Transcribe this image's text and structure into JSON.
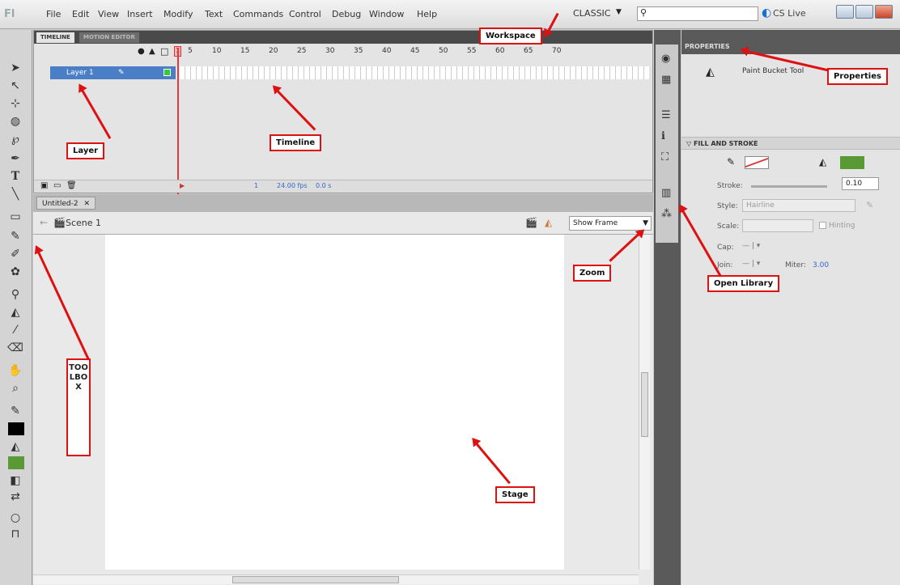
{
  "menu": {
    "items": [
      "File",
      "Edit",
      "View",
      "Insert",
      "Modify",
      "Text",
      "Commands",
      "Control",
      "Debug",
      "Window",
      "Help"
    ],
    "workspace": "CLASSIC",
    "cs_live": "CS Live"
  },
  "timeline": {
    "tabs": [
      "TIMELINE",
      "MOTION EDITOR"
    ],
    "frame_numbers": [
      "1",
      "5",
      "10",
      "15",
      "20",
      "25",
      "30",
      "35",
      "40",
      "45",
      "50",
      "55",
      "60",
      "65",
      "70"
    ],
    "layer_name": "Layer 1",
    "playhead_frame": "1",
    "fps": "24.00 fps",
    "elapsed": "0.0 s",
    "current_frame": "1"
  },
  "document": {
    "tab": "Untitled-2",
    "scene": "Scene 1",
    "zoom_value": "Show Frame"
  },
  "properties": {
    "tab": "PROPERTIES",
    "tool_name": "Paint Bucket Tool",
    "section": "FILL AND STROKE",
    "stroke_label": "Stroke:",
    "stroke_value": "0.10",
    "style_label": "Style:",
    "style_value": "Hairline",
    "scale_label": "Scale:",
    "hinting_label": "Hinting",
    "cap_label": "Cap:",
    "join_label": "Join:",
    "miter_label": "Miter:",
    "miter_value": "3.00",
    "fill_color": "#5a9a36"
  },
  "tools": {
    "fill_color": "#5a9a36",
    "stroke_color": "#000000"
  },
  "callouts": {
    "workspace": "Workspace",
    "properties": "Properties",
    "layer": "Layer",
    "timeline": "Timeline",
    "zoom": "Zoom",
    "open_library": "Open Library",
    "toolbox": "TOOLBOX",
    "stage": "Stage"
  }
}
